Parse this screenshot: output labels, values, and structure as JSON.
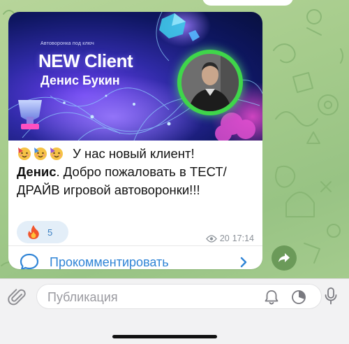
{
  "post": {
    "banner": {
      "small_title": "Автоворонка под ключ",
      "brand": "NEW Client",
      "person_name": "Денис Букин"
    },
    "text": {
      "line1": "У нас новый клиент!",
      "name_bold": "Денис",
      "line2_rest": ". Добро пожаловать в ТЕСТ/",
      "line3": "ДРАЙВ  игровой автоворонки!!!"
    },
    "emoji_names": [
      "partying-face",
      "partying-face",
      "partying-face"
    ],
    "reaction": {
      "emoji": "fire",
      "count": "5"
    },
    "meta": {
      "views": "20",
      "time": "17:14"
    },
    "comment_label": "Прокомментировать"
  },
  "composer": {
    "placeholder": "Публикация"
  },
  "colors": {
    "accent": "#2f84d6",
    "chat_bg": "#a6cc8c",
    "avatar_ring": "#3fd64a"
  }
}
